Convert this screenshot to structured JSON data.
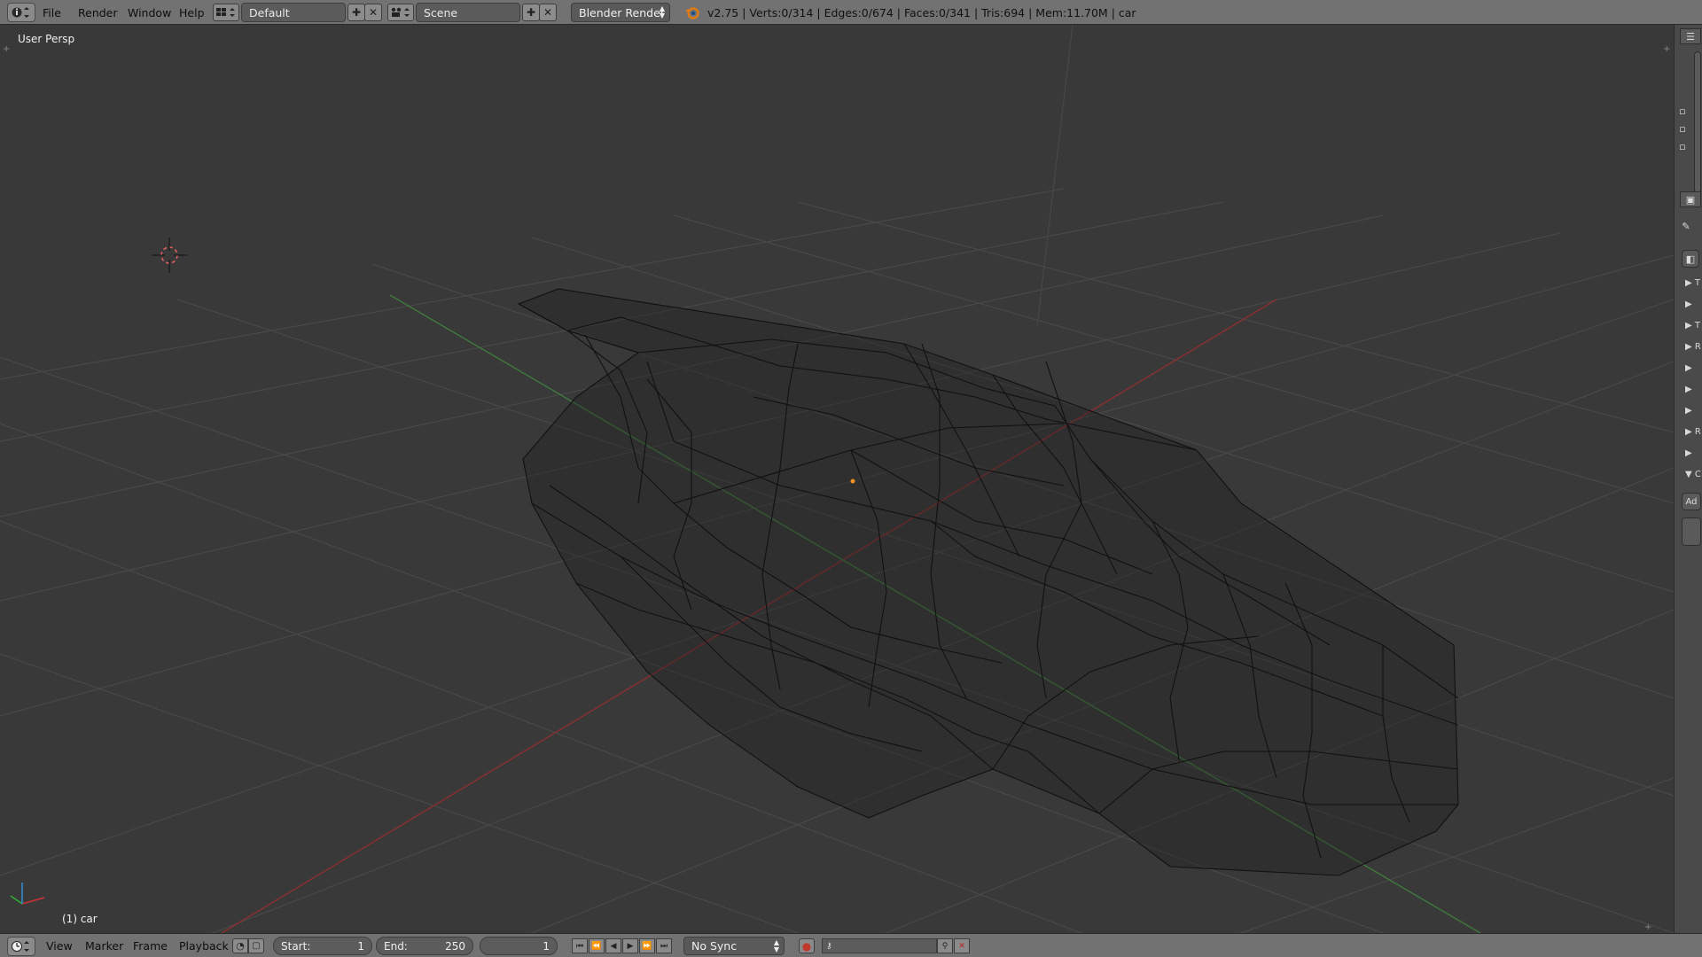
{
  "header": {
    "editor_type_icon": "info-icon",
    "menus": [
      "File",
      "Render",
      "Window",
      "Help"
    ],
    "layout_icon": "screen-layout-icon",
    "layout_name": "Default",
    "scene_icon": "scene-icon",
    "scene_name": "Scene",
    "render_engine": "Blender Render",
    "blender_logo": "blender-logo-icon",
    "stats": "v2.75 | Verts:0/314 | Edges:0/674 | Faces:0/341 | Tris:694 | Mem:11.70M | car"
  },
  "viewport": {
    "view_label": "User Persp",
    "object_label": "(1) car",
    "colors": {
      "background": "#393939",
      "grid": "#4b4b4b",
      "x_axis": "#8c2f2f",
      "y_axis": "#3e7a3e",
      "wire": "#111111",
      "origin": "#f09020"
    }
  },
  "right_panel": {
    "rows": [
      "T",
      "",
      "T",
      "R",
      "",
      "",
      "",
      "R",
      "",
      "C"
    ],
    "add_label": "Ad"
  },
  "timeline": {
    "editor_icon": "clock-icon",
    "menus": [
      "View",
      "Marker",
      "Frame",
      "Playback"
    ],
    "start_label": "Start:",
    "start_value": "1",
    "end_label": "End:",
    "end_value": "250",
    "current_frame": "1",
    "sync": "No Sync"
  }
}
